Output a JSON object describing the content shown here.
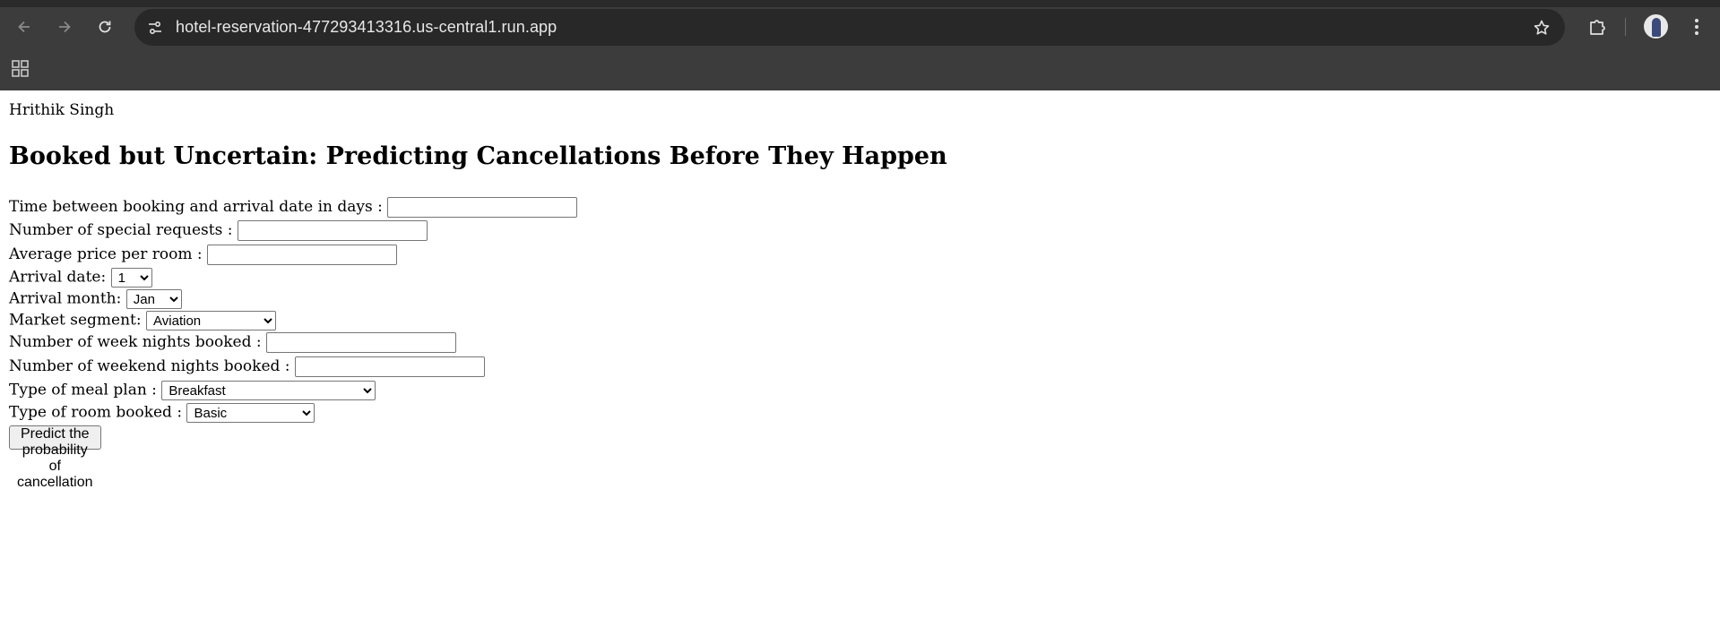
{
  "browser": {
    "url": "hotel-reservation-477293413316.us-central1.run.app",
    "icons": {
      "back": "arrow-left-icon",
      "forward": "arrow-right-icon",
      "reload": "reload-icon",
      "site_info": "tune-icon",
      "bookmark": "star-icon",
      "extensions": "puzzle-icon",
      "menu": "kebab-menu-icon",
      "apps": "apps-grid-icon"
    }
  },
  "page": {
    "author": "Hrithik Singh",
    "title": "Booked but Uncertain: Predicting Cancellations Before They Happen",
    "form": {
      "lead_time_label": "Time between booking and arrival date in days :",
      "lead_time_value": "",
      "special_requests_label": "Number of special requests :",
      "special_requests_value": "",
      "avg_price_label": "Average price per room :",
      "avg_price_value": "",
      "arrival_date_label": "Arrival date:",
      "arrival_date_selected": "1",
      "arrival_month_label": "Arrival month:",
      "arrival_month_selected": "Jan",
      "market_segment_label": "Market segment:",
      "market_segment_selected": "Aviation",
      "week_nights_label": "Number of week nights booked :",
      "week_nights_value": "",
      "weekend_nights_label": "Number of weekend nights booked :",
      "weekend_nights_value": "",
      "meal_plan_label": "Type of meal plan :",
      "meal_plan_selected": "Breakfast",
      "room_type_label": "Type of room booked :",
      "room_type_selected": "Basic",
      "submit_label": "Predict the probability of cancellation"
    }
  }
}
